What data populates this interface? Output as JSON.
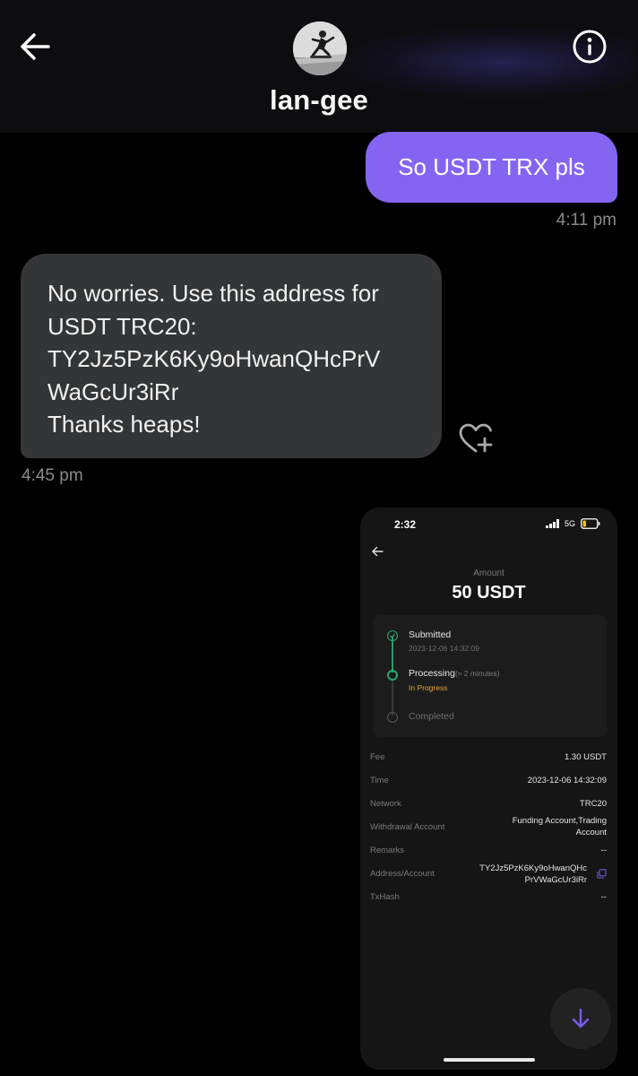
{
  "header": {
    "contact_name": "lan-gee",
    "back_icon": "back-arrow-icon",
    "info_icon": "info-icon",
    "avatar_icon": "avatar"
  },
  "messages": [
    {
      "direction": "outgoing",
      "text": "So USDT TRX pls",
      "time": "4:11 pm",
      "bubble_color": "#8465f2"
    },
    {
      "direction": "incoming",
      "lines": [
        "No worries. Use this address for",
        "USDT TRC20:",
        "TY2Jz5PzK6Ky9oHwanQHcPrV",
        "WaGcUr3iRr",
        "Thanks heaps!"
      ],
      "time": "4:45 pm",
      "bubble_color": "#333537",
      "reaction_icon": "heart-plus-icon"
    }
  ],
  "attachment": {
    "status_bar": {
      "time": "2:32",
      "network": "5G"
    },
    "amount_label": "Amount",
    "amount_value": "50 USDT",
    "timeline": [
      {
        "title": "Submitted",
        "sub": "2023-12-06 14:32:09",
        "state": "done"
      },
      {
        "title": "Processing",
        "note": "(≈ 2 minutes)",
        "sub": "In Progress",
        "state": "active"
      },
      {
        "title": "Completed",
        "state": "pending"
      }
    ],
    "details": [
      {
        "label": "Fee",
        "value": "1.30 USDT"
      },
      {
        "label": "Time",
        "value": "2023-12-06 14:32:09"
      },
      {
        "label": "Network",
        "value": "TRC20"
      },
      {
        "label": "Withdrawal Account",
        "value_lines": [
          "Funding Account,Trading",
          "Account"
        ]
      },
      {
        "label": "Remarks",
        "value": "--"
      },
      {
        "label": "Address/Account",
        "value_lines": [
          "TY2Jz5PzK6Ky9oHwanQHc",
          "PrVWaGcUr3iRr"
        ]
      },
      {
        "label": "TxHash",
        "value": "--"
      }
    ],
    "accent_color": "#7a5cf0",
    "success_color": "#2ea46f",
    "progress_color": "#e8a53a"
  },
  "fab_icon": "arrow-down-icon"
}
